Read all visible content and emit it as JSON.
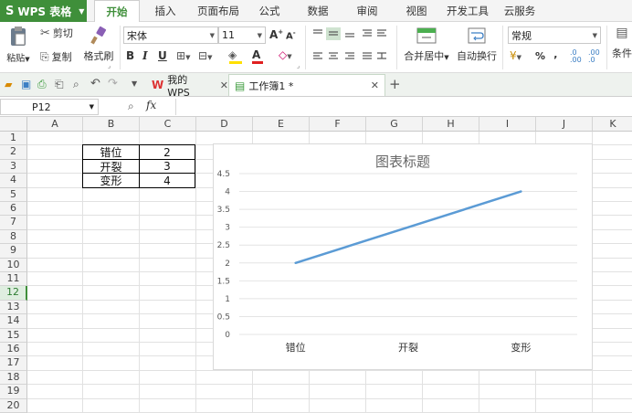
{
  "app": {
    "name": "WPS 表格"
  },
  "menu": {
    "tabs": [
      "开始",
      "插入",
      "页面布局",
      "公式",
      "数据",
      "审阅",
      "视图",
      "开发工具",
      "云服务"
    ]
  },
  "ribbon": {
    "paste_label": "粘贴",
    "cut_label": "剪切",
    "copy_label": "复制",
    "format_painter_label": "格式刷",
    "font_name": "宋体",
    "font_size": "11",
    "merge_label": "合并居中",
    "wrap_label": "自动换行",
    "number_format": "常规",
    "percent": "%",
    "thousand": " , ",
    "conditional_label": "条件"
  },
  "doc_tabs": [
    {
      "label": "我的WPS"
    },
    {
      "label": "工作簿1 *"
    }
  ],
  "formula_bar": {
    "cell_ref": "P12",
    "fx": "fx",
    "formula": ""
  },
  "grid": {
    "columns": [
      "A",
      "B",
      "C",
      "D",
      "E",
      "F",
      "G",
      "H",
      "I",
      "J",
      "K"
    ],
    "rows": [
      "1",
      "2",
      "3",
      "4",
      "5",
      "6",
      "7",
      "8",
      "9",
      "10",
      "11",
      "12",
      "13",
      "14",
      "15",
      "16",
      "17",
      "18",
      "19",
      "20"
    ],
    "selected_row": "12",
    "table": [
      {
        "label": "错位",
        "value": "2"
      },
      {
        "label": "开裂",
        "value": "3"
      },
      {
        "label": "变形",
        "value": "4"
      }
    ]
  },
  "chart_data": {
    "type": "line",
    "title": "图表标题",
    "categories": [
      "错位",
      "开裂",
      "变形"
    ],
    "series": [
      {
        "values": [
          2,
          3,
          4
        ],
        "color": "#5b9bd5"
      }
    ],
    "ylim": [
      0,
      4.5
    ],
    "yticks": [
      "0",
      "0.5",
      "1",
      "1.5",
      "2",
      "2.5",
      "3",
      "3.5",
      "4",
      "4.5"
    ],
    "grid": true,
    "legend": "none"
  }
}
